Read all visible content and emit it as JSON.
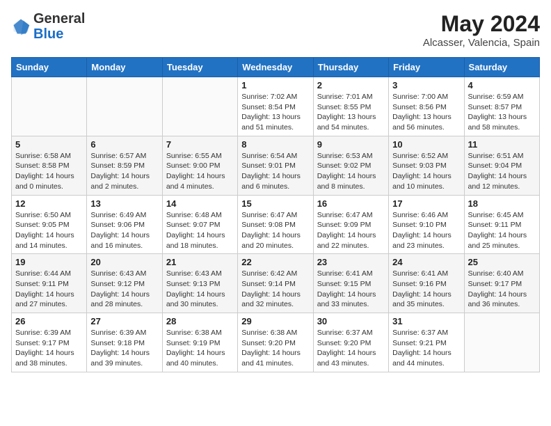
{
  "header": {
    "logo_general": "General",
    "logo_blue": "Blue",
    "month_year": "May 2024",
    "location": "Alcasser, Valencia, Spain"
  },
  "days_of_week": [
    "Sunday",
    "Monday",
    "Tuesday",
    "Wednesday",
    "Thursday",
    "Friday",
    "Saturday"
  ],
  "weeks": [
    [
      {
        "day": "",
        "info": ""
      },
      {
        "day": "",
        "info": ""
      },
      {
        "day": "",
        "info": ""
      },
      {
        "day": "1",
        "info": "Sunrise: 7:02 AM\nSunset: 8:54 PM\nDaylight: 13 hours\nand 51 minutes."
      },
      {
        "day": "2",
        "info": "Sunrise: 7:01 AM\nSunset: 8:55 PM\nDaylight: 13 hours\nand 54 minutes."
      },
      {
        "day": "3",
        "info": "Sunrise: 7:00 AM\nSunset: 8:56 PM\nDaylight: 13 hours\nand 56 minutes."
      },
      {
        "day": "4",
        "info": "Sunrise: 6:59 AM\nSunset: 8:57 PM\nDaylight: 13 hours\nand 58 minutes."
      }
    ],
    [
      {
        "day": "5",
        "info": "Sunrise: 6:58 AM\nSunset: 8:58 PM\nDaylight: 14 hours\nand 0 minutes."
      },
      {
        "day": "6",
        "info": "Sunrise: 6:57 AM\nSunset: 8:59 PM\nDaylight: 14 hours\nand 2 minutes."
      },
      {
        "day": "7",
        "info": "Sunrise: 6:55 AM\nSunset: 9:00 PM\nDaylight: 14 hours\nand 4 minutes."
      },
      {
        "day": "8",
        "info": "Sunrise: 6:54 AM\nSunset: 9:01 PM\nDaylight: 14 hours\nand 6 minutes."
      },
      {
        "day": "9",
        "info": "Sunrise: 6:53 AM\nSunset: 9:02 PM\nDaylight: 14 hours\nand 8 minutes."
      },
      {
        "day": "10",
        "info": "Sunrise: 6:52 AM\nSunset: 9:03 PM\nDaylight: 14 hours\nand 10 minutes."
      },
      {
        "day": "11",
        "info": "Sunrise: 6:51 AM\nSunset: 9:04 PM\nDaylight: 14 hours\nand 12 minutes."
      }
    ],
    [
      {
        "day": "12",
        "info": "Sunrise: 6:50 AM\nSunset: 9:05 PM\nDaylight: 14 hours\nand 14 minutes."
      },
      {
        "day": "13",
        "info": "Sunrise: 6:49 AM\nSunset: 9:06 PM\nDaylight: 14 hours\nand 16 minutes."
      },
      {
        "day": "14",
        "info": "Sunrise: 6:48 AM\nSunset: 9:07 PM\nDaylight: 14 hours\nand 18 minutes."
      },
      {
        "day": "15",
        "info": "Sunrise: 6:47 AM\nSunset: 9:08 PM\nDaylight: 14 hours\nand 20 minutes."
      },
      {
        "day": "16",
        "info": "Sunrise: 6:47 AM\nSunset: 9:09 PM\nDaylight: 14 hours\nand 22 minutes."
      },
      {
        "day": "17",
        "info": "Sunrise: 6:46 AM\nSunset: 9:10 PM\nDaylight: 14 hours\nand 23 minutes."
      },
      {
        "day": "18",
        "info": "Sunrise: 6:45 AM\nSunset: 9:11 PM\nDaylight: 14 hours\nand 25 minutes."
      }
    ],
    [
      {
        "day": "19",
        "info": "Sunrise: 6:44 AM\nSunset: 9:11 PM\nDaylight: 14 hours\nand 27 minutes."
      },
      {
        "day": "20",
        "info": "Sunrise: 6:43 AM\nSunset: 9:12 PM\nDaylight: 14 hours\nand 28 minutes."
      },
      {
        "day": "21",
        "info": "Sunrise: 6:43 AM\nSunset: 9:13 PM\nDaylight: 14 hours\nand 30 minutes."
      },
      {
        "day": "22",
        "info": "Sunrise: 6:42 AM\nSunset: 9:14 PM\nDaylight: 14 hours\nand 32 minutes."
      },
      {
        "day": "23",
        "info": "Sunrise: 6:41 AM\nSunset: 9:15 PM\nDaylight: 14 hours\nand 33 minutes."
      },
      {
        "day": "24",
        "info": "Sunrise: 6:41 AM\nSunset: 9:16 PM\nDaylight: 14 hours\nand 35 minutes."
      },
      {
        "day": "25",
        "info": "Sunrise: 6:40 AM\nSunset: 9:17 PM\nDaylight: 14 hours\nand 36 minutes."
      }
    ],
    [
      {
        "day": "26",
        "info": "Sunrise: 6:39 AM\nSunset: 9:17 PM\nDaylight: 14 hours\nand 38 minutes."
      },
      {
        "day": "27",
        "info": "Sunrise: 6:39 AM\nSunset: 9:18 PM\nDaylight: 14 hours\nand 39 minutes."
      },
      {
        "day": "28",
        "info": "Sunrise: 6:38 AM\nSunset: 9:19 PM\nDaylight: 14 hours\nand 40 minutes."
      },
      {
        "day": "29",
        "info": "Sunrise: 6:38 AM\nSunset: 9:20 PM\nDaylight: 14 hours\nand 41 minutes."
      },
      {
        "day": "30",
        "info": "Sunrise: 6:37 AM\nSunset: 9:20 PM\nDaylight: 14 hours\nand 43 minutes."
      },
      {
        "day": "31",
        "info": "Sunrise: 6:37 AM\nSunset: 9:21 PM\nDaylight: 14 hours\nand 44 minutes."
      },
      {
        "day": "",
        "info": ""
      }
    ]
  ]
}
